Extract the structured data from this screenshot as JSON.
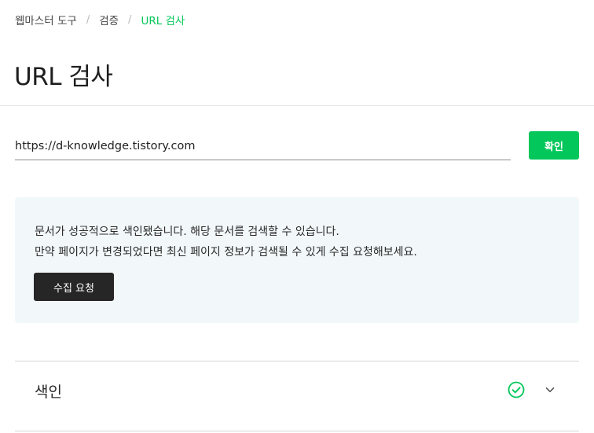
{
  "breadcrumb": {
    "items": [
      "웹마스터 도구",
      "검증",
      "URL 검사"
    ],
    "separator": "/"
  },
  "page_title": "URL 검사",
  "url_check": {
    "input_value": "https://d-knowledge.tistory.com",
    "confirm_label": "확인"
  },
  "status": {
    "line1": "문서가 성공적으로 색인됐습니다. 해당 문서를 검색할 수 있습니다.",
    "line2": "만약 페이지가 변경되었다면 최신 페이지 정보가 검색될 수 있게 수집 요청해보세요.",
    "request_label": "수집 요청"
  },
  "sections": [
    {
      "label": "색인",
      "status_icon": "check-circle-icon",
      "expand_icon": "chevron-down-icon"
    }
  ],
  "colors": {
    "accent": "#03c75a",
    "dark_button": "#262626",
    "panel_background": "#f2f7fa"
  }
}
